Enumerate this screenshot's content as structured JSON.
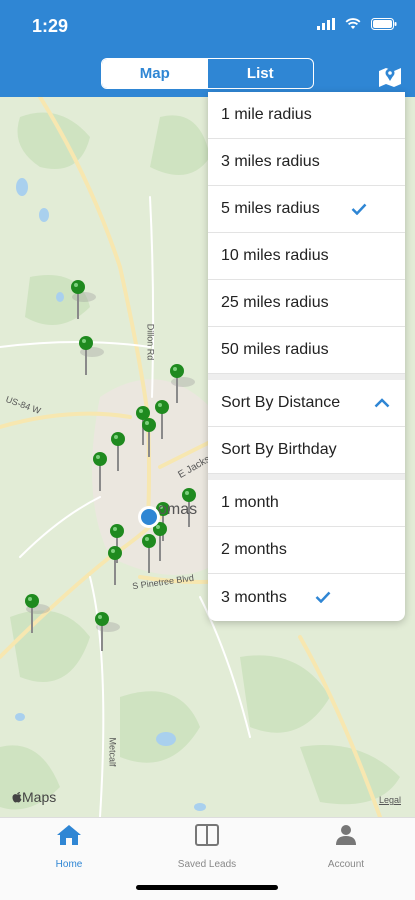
{
  "status": {
    "time": "1:29"
  },
  "header": {
    "segments": [
      {
        "label": "Map",
        "selected": true
      },
      {
        "label": "List",
        "selected": false
      }
    ]
  },
  "map": {
    "brand": "Maps",
    "legal": "Legal",
    "labels": [
      {
        "text": "US-84 W"
      },
      {
        "text": "Dillon Rd"
      },
      {
        "text": "E Jackson"
      },
      {
        "text": "omas"
      },
      {
        "text": "S Pinetree Blvd"
      },
      {
        "text": "Metcalf"
      }
    ]
  },
  "dropdown": {
    "radius_options": [
      {
        "label": "1 mile radius",
        "checked": false
      },
      {
        "label": "3 miles radius",
        "checked": false
      },
      {
        "label": "5 miles radius",
        "checked": true
      },
      {
        "label": "10 miles radius",
        "checked": false
      },
      {
        "label": "25 miles radius",
        "checked": false
      },
      {
        "label": "50 miles radius",
        "checked": false
      }
    ],
    "sort_options": [
      {
        "label": "Sort By Distance",
        "expanded": true
      },
      {
        "label": "Sort By Birthday"
      }
    ],
    "period_options": [
      {
        "label": "1 month",
        "checked": false
      },
      {
        "label": "2 months",
        "checked": false
      },
      {
        "label": "3 months",
        "checked": true
      }
    ]
  },
  "tabbar": {
    "tabs": [
      {
        "label": "Home",
        "icon": "home-icon",
        "active": true
      },
      {
        "label": "Saved Leads",
        "icon": "book-icon",
        "active": false
      },
      {
        "label": "Account",
        "icon": "person-icon",
        "active": false
      }
    ]
  },
  "colors": {
    "accent": "#2f86d4",
    "pin": "#1f8a1f",
    "user_location": "#2f86d4"
  }
}
